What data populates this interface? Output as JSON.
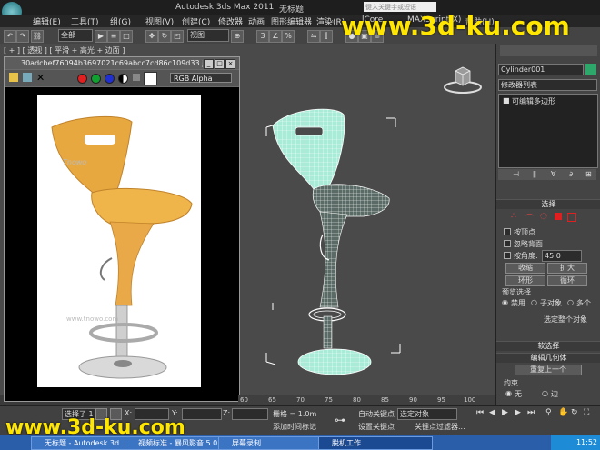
{
  "titlebar": {
    "app_title": "Autodesk 3ds Max  2011",
    "file_title": "无标题",
    "search_placeholder": "键入关键字或短语"
  },
  "menu": [
    "编辑(E)",
    "工具(T)",
    "组(G)",
    "视图(V)",
    "创建(C)",
    "修改器",
    "动画",
    "图形编辑器",
    "渲染(R)",
    "lCore",
    "MAXScript(X)",
    "帮助(H)"
  ],
  "toolbar": {
    "selection_filter": "全部",
    "coord_system": "视图"
  },
  "viewport": {
    "label": "[ + ] [ 透视 ] [ 平滑 + 高光 + 边面 ]"
  },
  "image_window": {
    "title": "30adcbef76094b3697021c69abcc7cd86c109d33.jpg",
    "channel": "RGB Alpha",
    "photo_watermarks": [
      "Tnowo",
      "www.tnowo.com"
    ]
  },
  "command_panel": {
    "object_name": "Cylinder001",
    "modifier_list": "修改器列表",
    "stack_item": "可编辑多边形",
    "selection_rollout": "选择",
    "by_vertex": "按顶点",
    "ignore_backfacing": "忽略背面",
    "by_angle": "按角度:",
    "angle_value": "45.0",
    "shrink": "收缩",
    "grow": "扩大",
    "ring": "环形",
    "loop": "循环",
    "preview_selection": "预览选择",
    "disabled": "禁用",
    "subobject": "子对象",
    "multi": "多个",
    "select_whole": "选定整个对象",
    "soft_selection": "软选择",
    "edit_geometry": "编辑几何体",
    "repeat_last": "重复上一个",
    "constraints": "约束",
    "none": "无",
    "edge": "边"
  },
  "timeline": {
    "ticks": [
      "60",
      "65",
      "70",
      "75",
      "80",
      "85",
      "90",
      "95",
      "100"
    ]
  },
  "statusbar": {
    "selected_label": "选择了 1",
    "x_label": "X:",
    "y_label": "Y:",
    "z_label": "Z:",
    "grid": "栅格 = 1.0m",
    "auto_key": "自动关键点",
    "selected_object": "选定对象",
    "add_time_tag": "添加时间标记",
    "set_key": "设置关键点",
    "key_filters": "关键点过滤器..."
  },
  "taskbar": {
    "tasks": [
      "无标题 - Autodesk 3d...",
      "视频标准 - 暴风影音 5.0",
      "屏幕录制"
    ],
    "active_window": "脱机工作",
    "clock": "11:52"
  },
  "watermark": {
    "text": "www.3d-ku.com"
  },
  "colors": {
    "watermark": "#ffe600",
    "wireframe": "#ffffff",
    "mesh_face": "#9fe8d2",
    "taskbar": "#2a5ea8",
    "viewport_bg": "#4a4a4a"
  }
}
